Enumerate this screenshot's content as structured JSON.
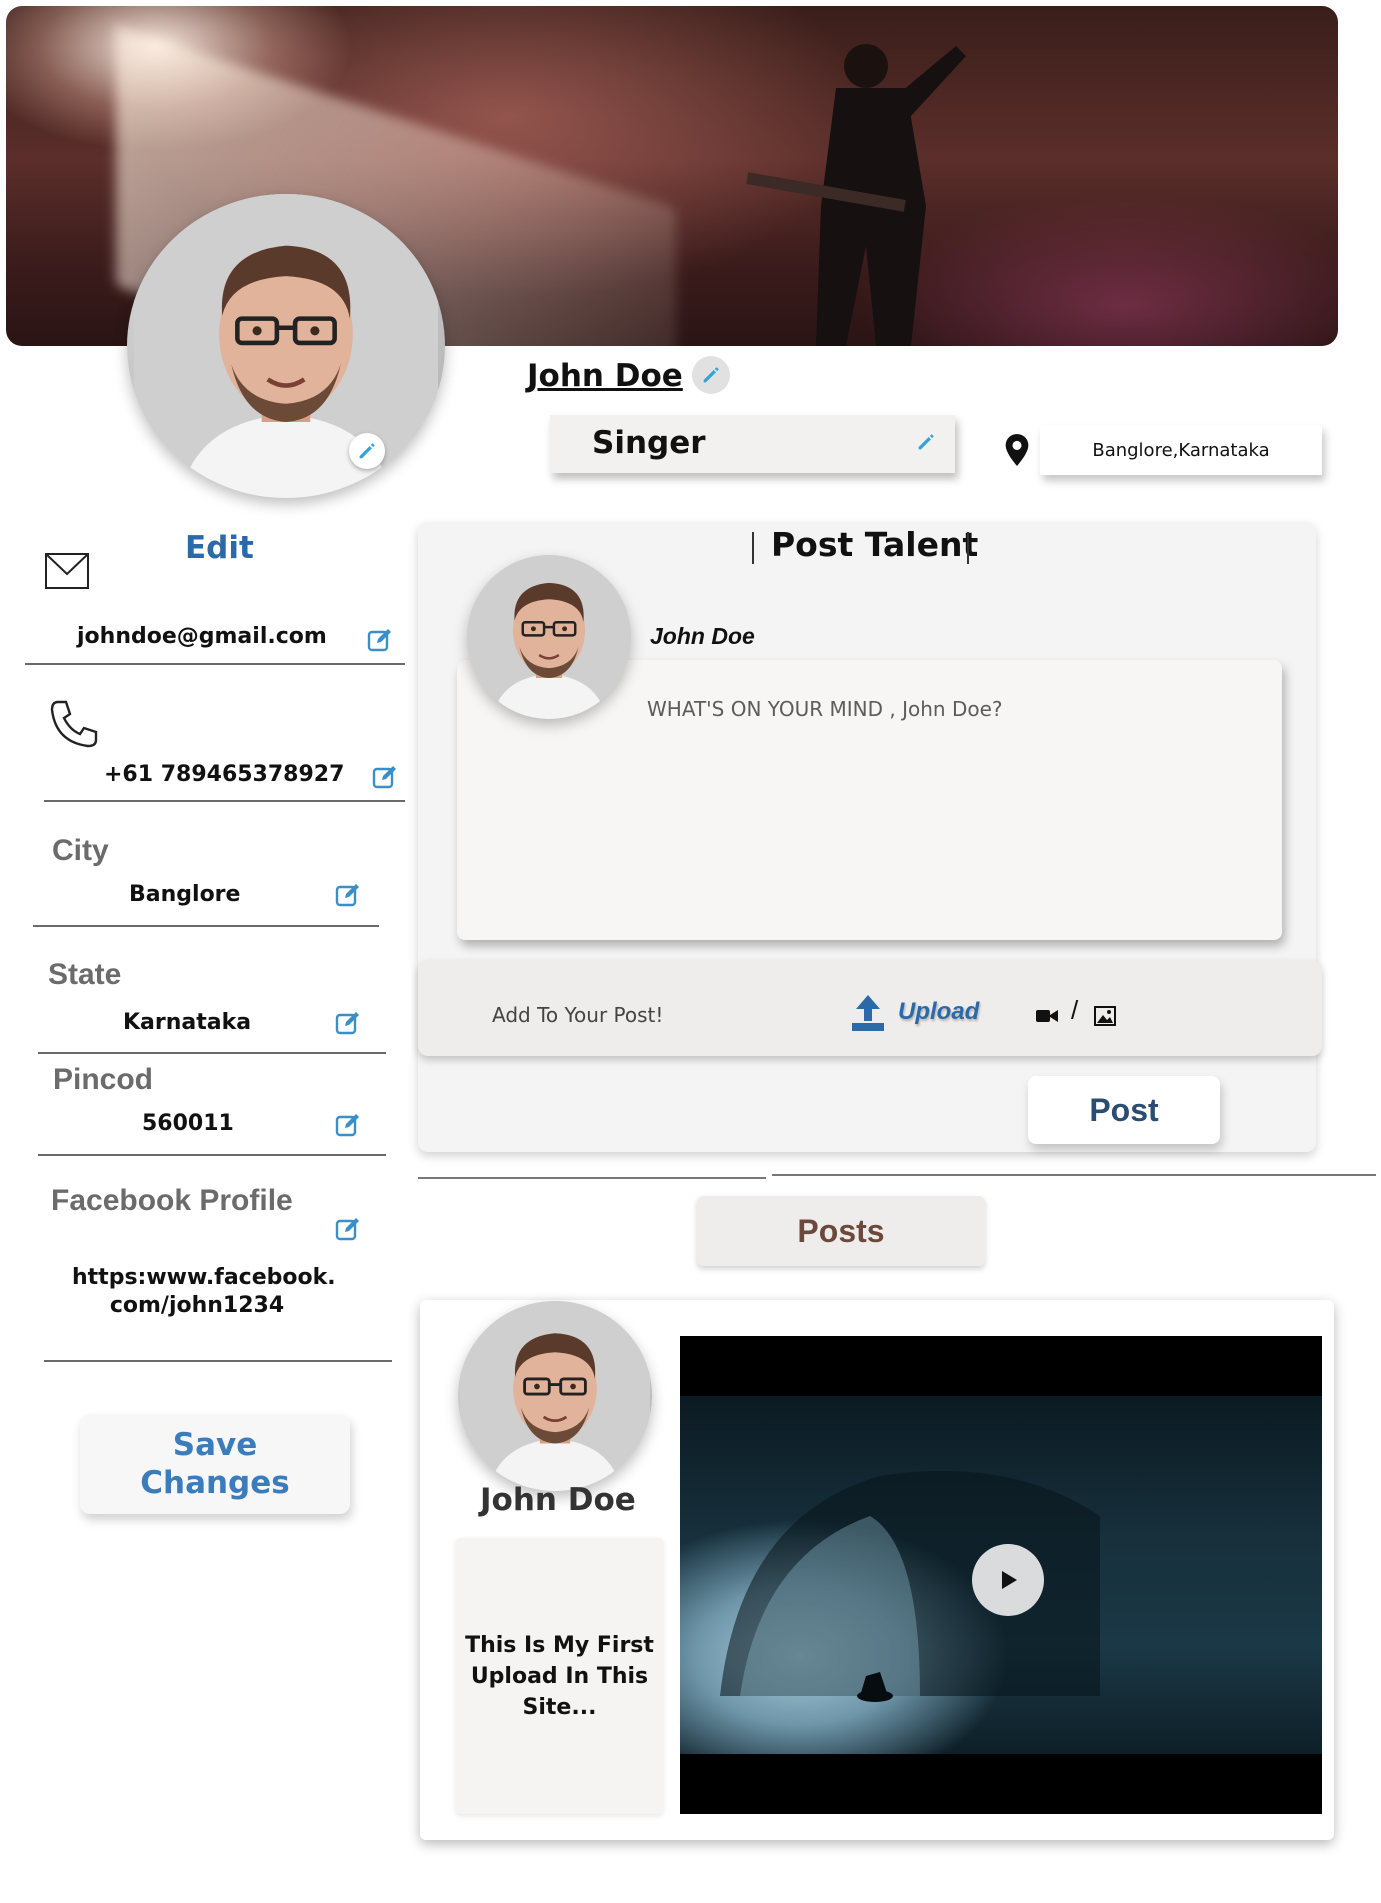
{
  "profile": {
    "name": "John Doe",
    "role": "Singer",
    "location": "Banglore,Karnataka"
  },
  "sidebar": {
    "edit_heading": "Edit",
    "email": "johndoe@gmail.com",
    "phone": "+61 789465378927",
    "city_label": "City",
    "city": "Banglore",
    "state_label": "State",
    "state": "Karnataka",
    "pincode_label": "Pincod",
    "pincode": "560011",
    "facebook_label": "Facebook Profile",
    "facebook_line1": "https:www.facebook.",
    "facebook_line2": "com/john1234",
    "save_label_line1": "Save",
    "save_label_line2": "Changes"
  },
  "talent": {
    "title": "Post Talent",
    "username": "John Doe",
    "placeholder": "WHAT'S ON YOUR MIND , John Doe?",
    "add_to_post": "Add To Your Post!",
    "upload_label": "Upload",
    "slash": "/",
    "post_button": "Post"
  },
  "posts": {
    "tab_label": "Posts",
    "items": [
      {
        "author": "John Doe",
        "caption_line1": "This Is My First",
        "caption_line2": "Upload In This",
        "caption_line3": "Site..."
      }
    ]
  },
  "colors": {
    "accent_blue": "#2b6aa8",
    "icon_blue": "#3aa0d8",
    "posts_tab_text": "#6b4a3c"
  }
}
